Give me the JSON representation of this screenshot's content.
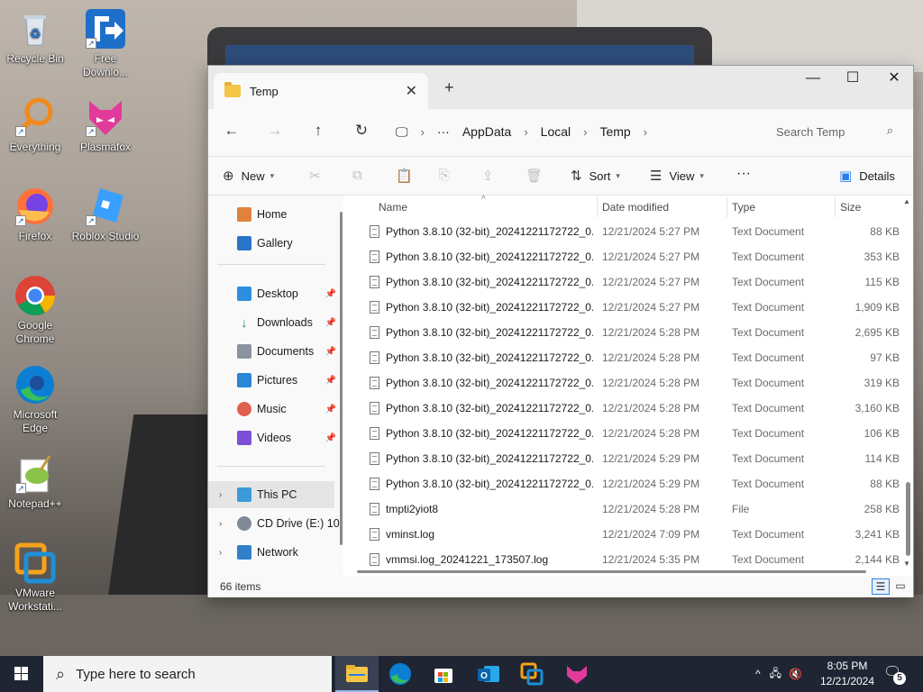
{
  "desktop": {
    "icons": [
      {
        "label": "Recycle Bin"
      },
      {
        "label": "Free Downlo..."
      },
      {
        "label": "Everything"
      },
      {
        "label": "Plasmafox"
      },
      {
        "label": "Firefox"
      },
      {
        "label": "Roblox Studio"
      },
      {
        "label": "Google Chrome"
      },
      {
        "label": "Microsoft Edge"
      },
      {
        "label": "Notepad++"
      },
      {
        "label": "VMware Workstati..."
      }
    ]
  },
  "window": {
    "tab_title": "Temp",
    "breadcrumb": [
      "AppData",
      "Local",
      "Temp"
    ],
    "search_placeholder": "Search Temp",
    "commands": {
      "new": "New",
      "sort": "Sort",
      "view": "View",
      "details": "Details"
    },
    "nav": {
      "home": "Home",
      "gallery": "Gallery",
      "desktop": "Desktop",
      "downloads": "Downloads",
      "documents": "Documents",
      "pictures": "Pictures",
      "music": "Music",
      "videos": "Videos",
      "this_pc": "This PC",
      "cd_drive": "CD Drive (E:) 10",
      "network": "Network"
    },
    "columns": {
      "name": "Name",
      "date": "Date modified",
      "type": "Type",
      "size": "Size"
    },
    "files": [
      {
        "name": "Python 3.8.10 (32-bit)_20241221172722_0...",
        "date": "12/21/2024 5:27 PM",
        "type": "Text Document",
        "size": "88 KB"
      },
      {
        "name": "Python 3.8.10 (32-bit)_20241221172722_0...",
        "date": "12/21/2024 5:27 PM",
        "type": "Text Document",
        "size": "353 KB"
      },
      {
        "name": "Python 3.8.10 (32-bit)_20241221172722_0...",
        "date": "12/21/2024 5:27 PM",
        "type": "Text Document",
        "size": "115 KB"
      },
      {
        "name": "Python 3.8.10 (32-bit)_20241221172722_0...",
        "date": "12/21/2024 5:27 PM",
        "type": "Text Document",
        "size": "1,909 KB"
      },
      {
        "name": "Python 3.8.10 (32-bit)_20241221172722_0...",
        "date": "12/21/2024 5:28 PM",
        "type": "Text Document",
        "size": "2,695 KB"
      },
      {
        "name": "Python 3.8.10 (32-bit)_20241221172722_0...",
        "date": "12/21/2024 5:28 PM",
        "type": "Text Document",
        "size": "97 KB"
      },
      {
        "name": "Python 3.8.10 (32-bit)_20241221172722_0...",
        "date": "12/21/2024 5:28 PM",
        "type": "Text Document",
        "size": "319 KB"
      },
      {
        "name": "Python 3.8.10 (32-bit)_20241221172722_0...",
        "date": "12/21/2024 5:28 PM",
        "type": "Text Document",
        "size": "3,160 KB"
      },
      {
        "name": "Python 3.8.10 (32-bit)_20241221172722_0...",
        "date": "12/21/2024 5:28 PM",
        "type": "Text Document",
        "size": "106 KB"
      },
      {
        "name": "Python 3.8.10 (32-bit)_20241221172722_0...",
        "date": "12/21/2024 5:29 PM",
        "type": "Text Document",
        "size": "114 KB"
      },
      {
        "name": "Python 3.8.10 (32-bit)_20241221172722_0...",
        "date": "12/21/2024 5:29 PM",
        "type": "Text Document",
        "size": "88 KB"
      },
      {
        "name": "tmpti2yiot8",
        "date": "12/21/2024 5:28 PM",
        "type": "File",
        "size": "258 KB"
      },
      {
        "name": "vminst.log",
        "date": "12/21/2024 7:09 PM",
        "type": "Text Document",
        "size": "3,241 KB"
      },
      {
        "name": "vmmsi.log_20241221_173507.log",
        "date": "12/21/2024 5:35 PM",
        "type": "Text Document",
        "size": "2,144 KB"
      }
    ],
    "status": "66 items"
  },
  "taskbar": {
    "search_placeholder": "Type here to search",
    "time": "8:05 PM",
    "date": "12/21/2024",
    "notification_count": "5"
  },
  "colors": {
    "taskbar": "#1f2532",
    "accent": "#2b7de9",
    "folder": "#f4c646"
  }
}
